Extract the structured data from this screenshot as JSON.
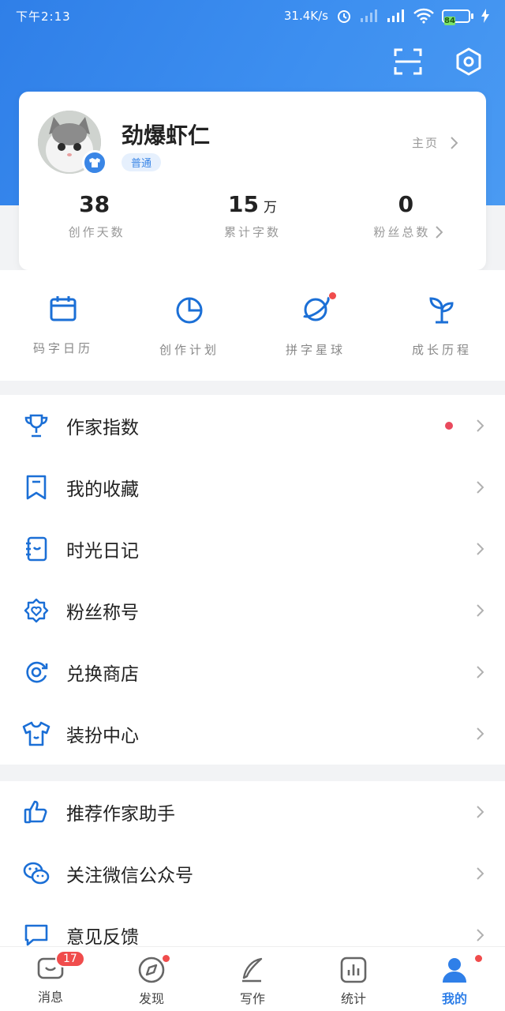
{
  "status_bar": {
    "time": "下午2:13",
    "net_speed": "31.4K/s",
    "battery": "84"
  },
  "profile": {
    "name": "劲爆虾仁",
    "level": "普通",
    "homepage_label": "主页",
    "stats": [
      {
        "value": "38",
        "unit": "",
        "label": "创作天数"
      },
      {
        "value": "15",
        "unit": "万",
        "label": "累计字数"
      },
      {
        "value": "0",
        "unit": "",
        "label": "粉丝总数"
      }
    ]
  },
  "quick_actions": [
    {
      "label": "码字日历",
      "icon": "calendar-icon"
    },
    {
      "label": "创作计划",
      "icon": "pie-chart-icon"
    },
    {
      "label": "拼字星球",
      "icon": "planet-icon"
    },
    {
      "label": "成长历程",
      "icon": "sprout-icon"
    }
  ],
  "menu_group_1": [
    {
      "label": "作家指数",
      "icon": "trophy-icon"
    },
    {
      "label": "我的收藏",
      "icon": "bookmark-icon"
    },
    {
      "label": "时光日记",
      "icon": "diary-icon"
    },
    {
      "label": "粉丝称号",
      "icon": "badge-heart-icon"
    },
    {
      "label": "兑换商店",
      "icon": "exchange-icon"
    },
    {
      "label": "装扮中心",
      "icon": "tshirt-icon"
    }
  ],
  "menu_group_2": [
    {
      "label": "推荐作家助手",
      "icon": "thumbs-up-icon"
    },
    {
      "label": "关注微信公众号",
      "icon": "wechat-icon"
    },
    {
      "label": "意见反馈",
      "icon": "chat-bubble-icon"
    }
  ],
  "tabbar": {
    "tabs": [
      {
        "label": "消息",
        "badge": "17"
      },
      {
        "label": "发现"
      },
      {
        "label": "写作"
      },
      {
        "label": "统计"
      },
      {
        "label": "我的"
      }
    ]
  },
  "colors": {
    "brand": "#2f7fe8",
    "red_dot": "#f04c4c"
  }
}
